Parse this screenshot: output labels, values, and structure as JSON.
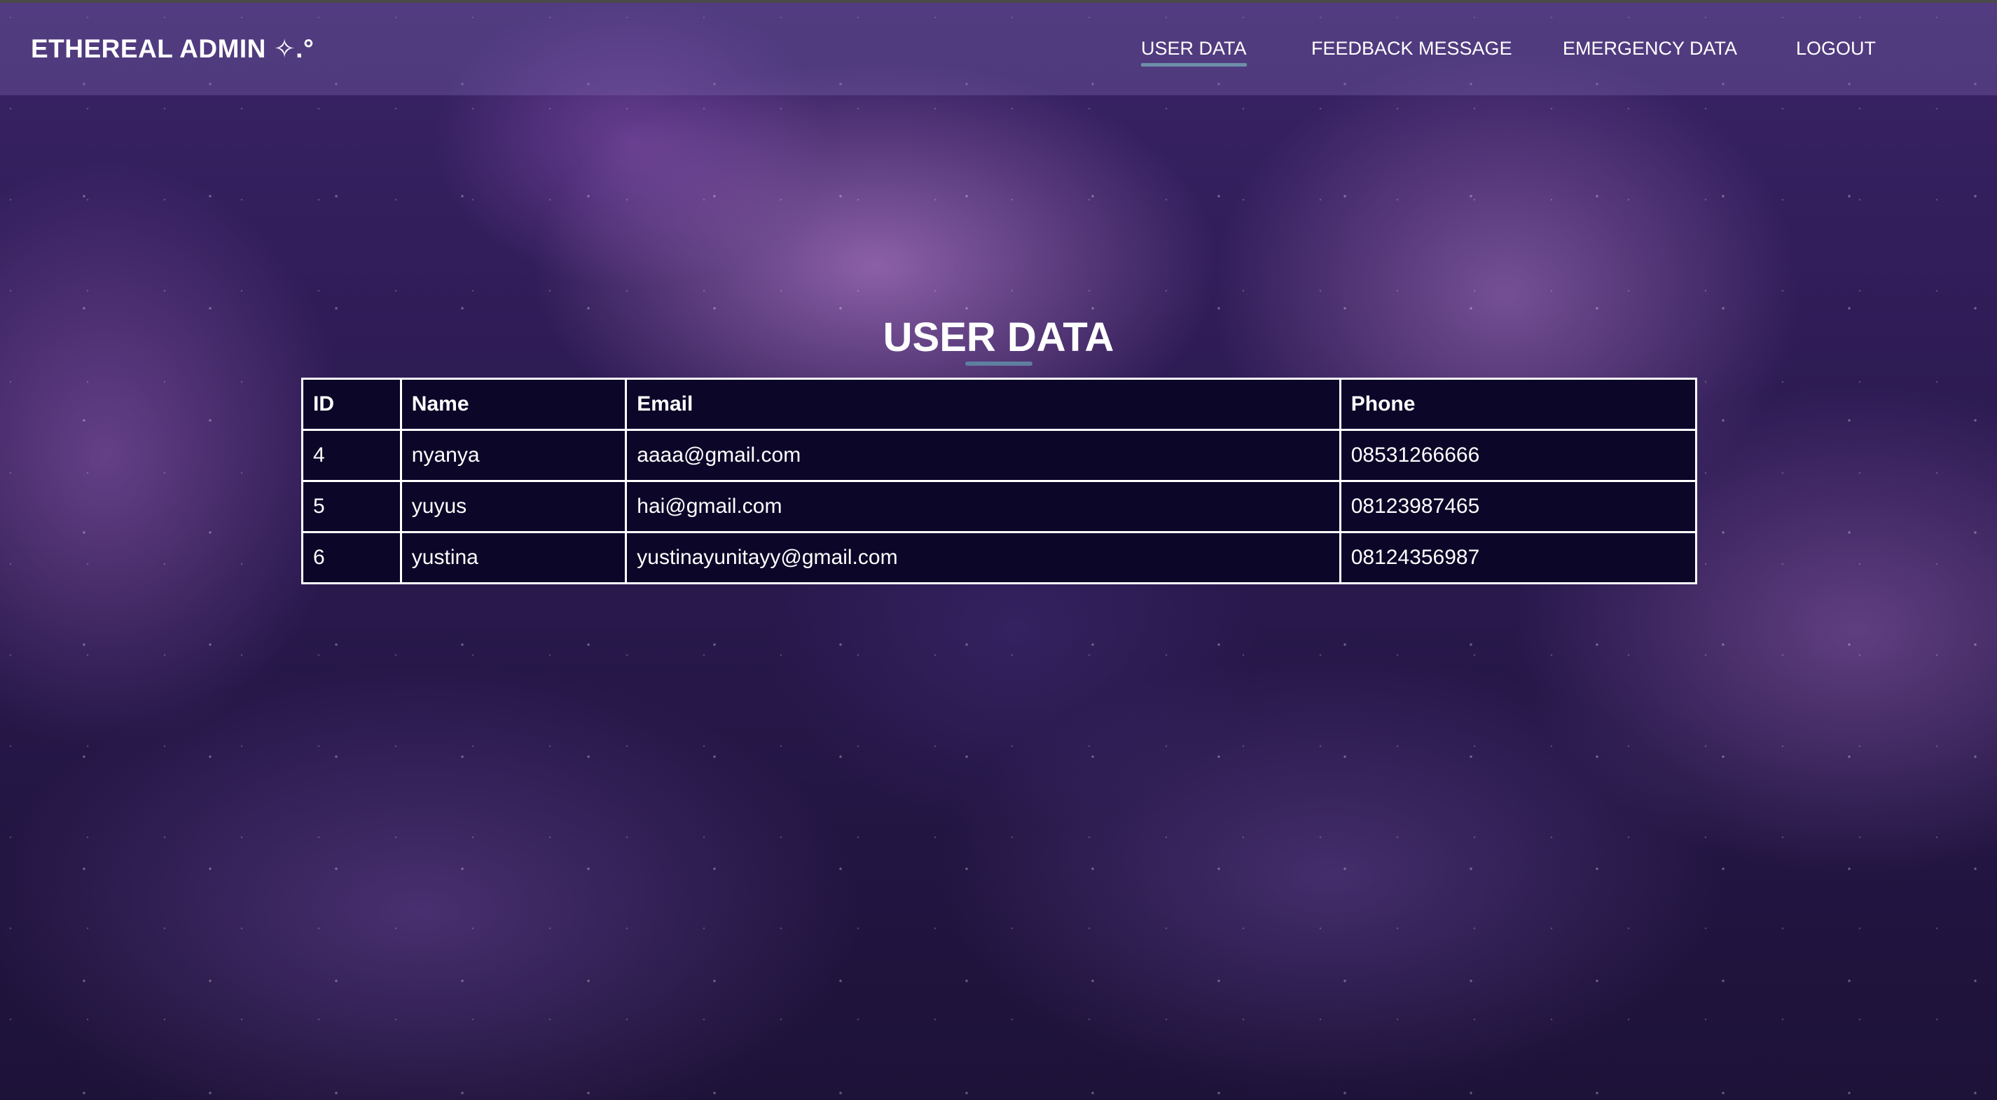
{
  "brand": {
    "title": "ETHEREAL ADMIN ✧.°"
  },
  "nav": {
    "items": [
      {
        "label": "USER DATA",
        "active": true
      },
      {
        "label": "FEEDBACK MESSAGE",
        "active": false
      },
      {
        "label": "EMERGENCY DATA",
        "active": false
      },
      {
        "label": "LOGOUT",
        "active": false
      }
    ]
  },
  "main": {
    "title": "USER DATA",
    "table": {
      "headers": [
        "ID",
        "Name",
        "Email",
        "Phone"
      ],
      "rows": [
        [
          "4",
          "nyanya",
          "aaaa@gmail.com",
          "08531266666"
        ],
        [
          "5",
          "yuyus",
          "hai@gmail.com",
          "08123987465"
        ],
        [
          "6",
          "yustina",
          "yustinayunitayy@gmail.com",
          "08124356987"
        ]
      ]
    }
  },
  "colors": {
    "navbar": "#7864aa",
    "table_bg": "#0c0628",
    "accent_underline": "#6d8fa8",
    "text": "#ffffff"
  }
}
